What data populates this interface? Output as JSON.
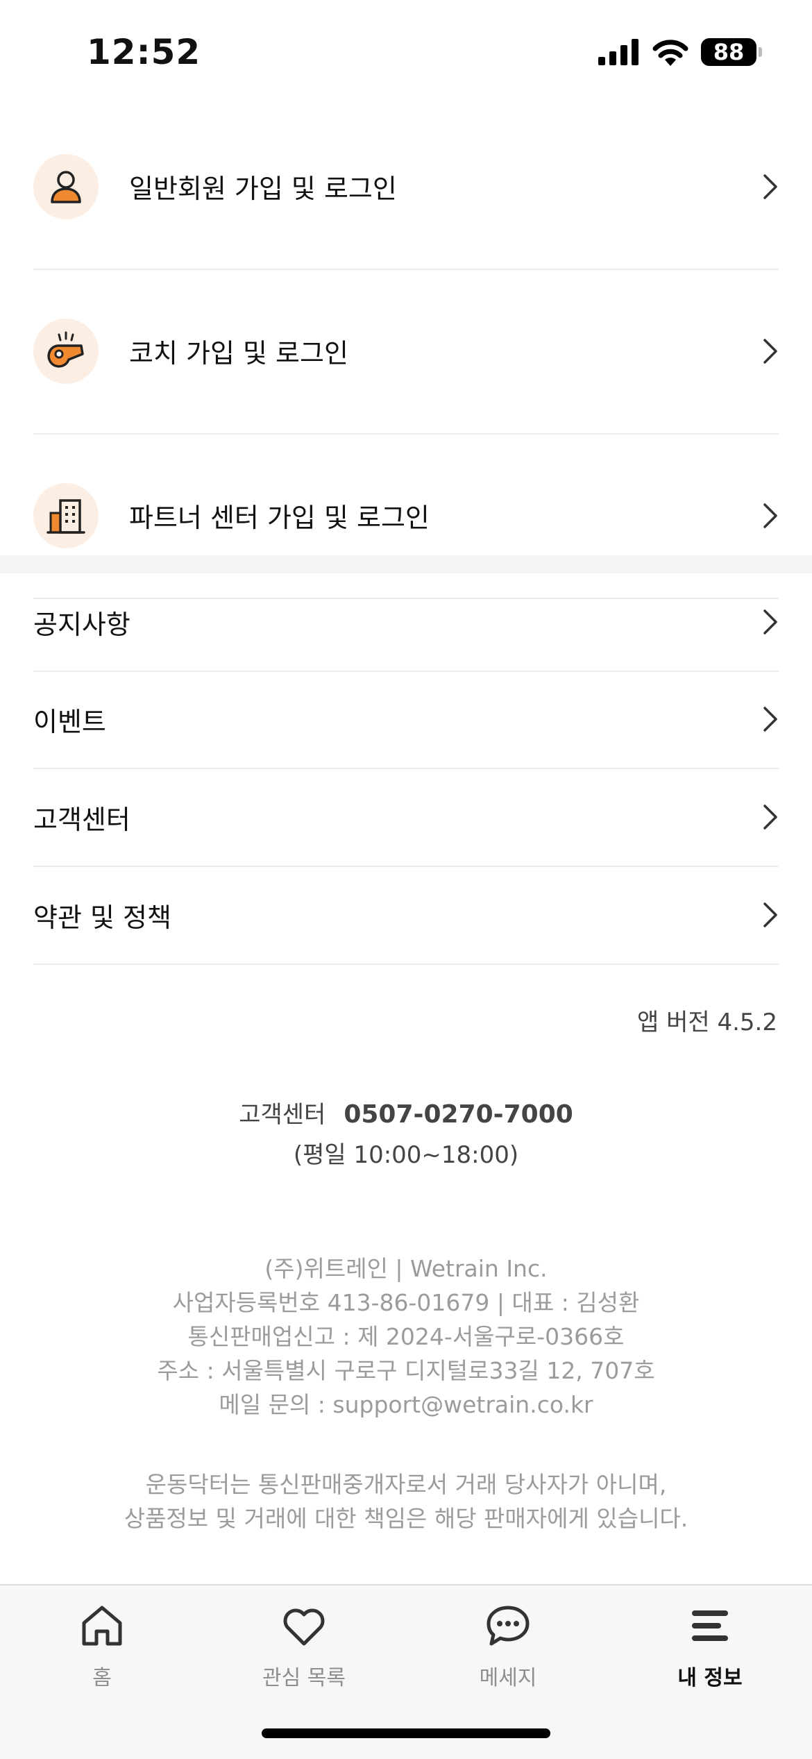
{
  "status_bar": {
    "time": "12:52",
    "battery": "88"
  },
  "login_items": [
    {
      "label": "일반회원 가입 및 로그인",
      "icon": "person-icon"
    },
    {
      "label": "코치 가입 및 로그인",
      "icon": "whistle-icon"
    },
    {
      "label": "파트너 센터 가입 및 로그인",
      "icon": "building-icon"
    }
  ],
  "menu_items": [
    {
      "label": "공지사항"
    },
    {
      "label": "이벤트"
    },
    {
      "label": "고객센터"
    },
    {
      "label": "약관 및 정책"
    }
  ],
  "app_version": "앱 버전 4.5.2",
  "customer_service": {
    "label": "고객센터",
    "phone": "0507-0270-7000",
    "hours": "(평일 10:00~18:00)"
  },
  "company_info": {
    "line1": "(주)위트레인  |  Wetrain Inc.",
    "line2": "사업자등록번호 413-86-01679  |  대표 : 김성환",
    "line3": "통신판매업신고 : 제 2024-서울구로-0366호",
    "line4": "주소 : 서울특별시 구로구 디지털로33길 12, 707호",
    "line5": "메일 문의 : support@wetrain.co.kr"
  },
  "disclaimer": {
    "line1": "운동닥터는 통신판매중개자로서 거래 당사자가 아니며,",
    "line2": "상품정보 및 거래에 대한 책임은 해당 판매자에게 있습니다."
  },
  "tab_bar": {
    "tabs": [
      {
        "label": "홈",
        "icon": "home-icon"
      },
      {
        "label": "관심 목록",
        "icon": "heart-icon"
      },
      {
        "label": "메세지",
        "icon": "chat-bubble-icon"
      },
      {
        "label": "내 정보",
        "icon": "menu-icon"
      }
    ],
    "active": "내 정보"
  },
  "colors": {
    "accent": "#f0892f",
    "icon_bg": "#fdeee3",
    "text_primary": "#111111",
    "text_muted": "#9b9b9b"
  }
}
